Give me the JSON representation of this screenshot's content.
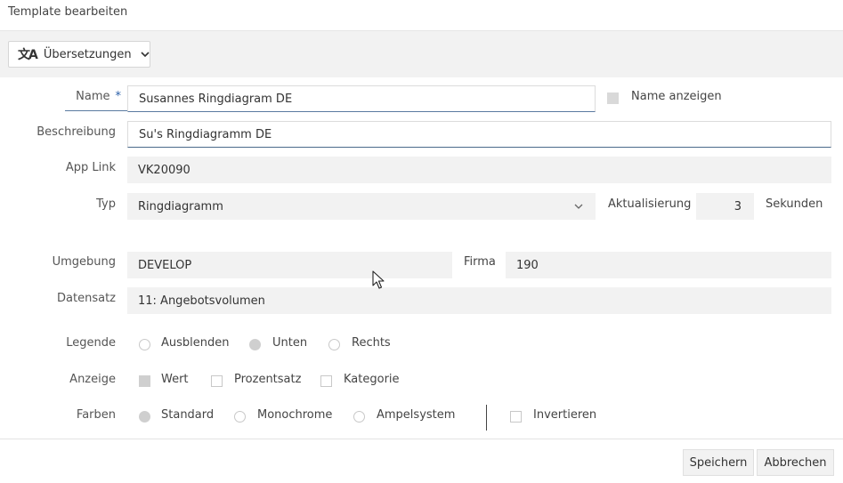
{
  "window": {
    "title": "Template bearbeiten"
  },
  "toolbar": {
    "translations_label": "Übersetzungen",
    "translations_icon": "translate-icon"
  },
  "form": {
    "name": {
      "label": "Name",
      "required_mark": "*",
      "value": "Susannes Ringdiagram DE"
    },
    "show_name": {
      "label": "Name anzeigen",
      "checked": false
    },
    "description": {
      "label": "Beschreibung",
      "value": "Su's Ringdiagramm DE"
    },
    "app_link": {
      "label": "App Link",
      "value": "VK20090"
    },
    "type": {
      "label": "Typ",
      "value": "Ringdiagramm"
    },
    "refresh": {
      "label": "Aktualisierung",
      "value": "3",
      "unit": "Sekunden"
    },
    "environment": {
      "label": "Umgebung",
      "value": "DEVELOP"
    },
    "company": {
      "label": "Firma",
      "value": "190"
    },
    "dataset": {
      "label": "Datensatz",
      "value": "11: Angebotsvolumen"
    },
    "legend": {
      "label": "Legende",
      "options": [
        "Ausblenden",
        "Unten",
        "Rechts"
      ],
      "selected": "Unten"
    },
    "display": {
      "label": "Anzeige",
      "options": [
        "Wert",
        "Prozentsatz",
        "Kategorie"
      ],
      "checked": [
        "Wert"
      ]
    },
    "colors": {
      "label": "Farben",
      "options": [
        "Standard",
        "Monochrome",
        "Ampelsystem"
      ],
      "selected": "Standard",
      "invert_label": "Invertieren",
      "invert_checked": false
    }
  },
  "footer": {
    "save_label": "Speichern",
    "cancel_label": "Abbrechen"
  },
  "colors": {
    "accent": "#2a5fa8",
    "field_bg": "#f2f2f2",
    "toolbar_bg": "#f2f2f2"
  }
}
